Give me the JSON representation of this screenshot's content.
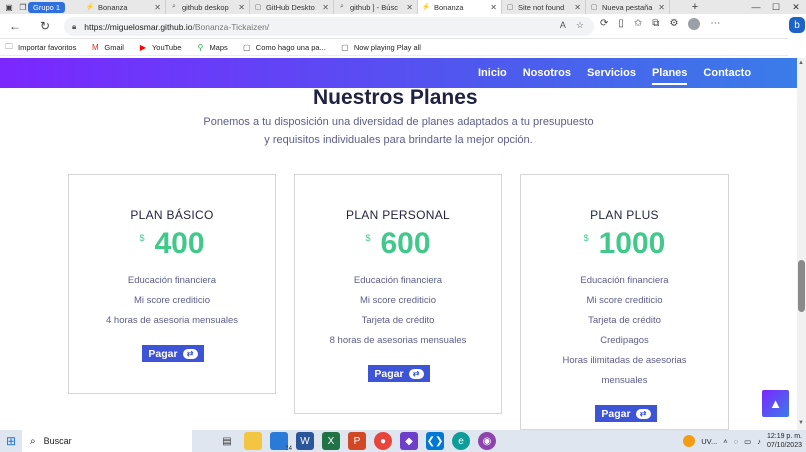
{
  "browser": {
    "group_chip": "Grupo 1",
    "tabs": [
      {
        "title": "Bonanza",
        "icon": "bonanza-icon",
        "active": false
      },
      {
        "title": "github deskop",
        "icon": "search-icon",
        "active": false
      },
      {
        "title": "GitHub Deskto",
        "icon": "page-icon",
        "active": false
      },
      {
        "title": "github ] - Búsc",
        "icon": "search-icon",
        "active": false
      },
      {
        "title": "Bonanza",
        "icon": "bonanza-icon",
        "active": true
      },
      {
        "title": "Site not found",
        "icon": "page-icon",
        "active": false
      },
      {
        "title": "Nueva pestaña",
        "icon": "newtab-icon",
        "active": false
      }
    ],
    "url_host": "https://miguelosmar.github.io",
    "url_path": "/Bonanza-Tickaizen/",
    "bookmarks": [
      {
        "label": "Importar favoritos",
        "icon": "folder-icon"
      },
      {
        "label": "Gmail",
        "icon": "gmail-icon"
      },
      {
        "label": "YouTube",
        "icon": "youtube-icon"
      },
      {
        "label": "Maps",
        "icon": "maps-icon"
      },
      {
        "label": "Como hago una pa...",
        "icon": "page-icon"
      },
      {
        "label": "Now playing Play all",
        "icon": "page-icon"
      }
    ]
  },
  "site": {
    "nav": [
      {
        "label": "Inicio",
        "active": false
      },
      {
        "label": "Nosotros",
        "active": false
      },
      {
        "label": "Servicios",
        "active": false
      },
      {
        "label": "Planes",
        "active": true
      },
      {
        "label": "Contacto",
        "active": false
      }
    ],
    "section_title": "Nuestros Planes",
    "section_sub_line1": "Ponemos a tu disposición una diversidad de planes adaptados a tu presupuesto",
    "section_sub_line2": "y requisitos individuales para brindarte la mejor opción.",
    "pay_label": "Pagar",
    "plans": [
      {
        "name": "PLAN BÁSICO",
        "currency": "$",
        "price": "400",
        "features": [
          "Educación financiera",
          "Mi score crediticio",
          "4 horas de asesoria mensuales"
        ]
      },
      {
        "name": "PLAN PERSONAL",
        "currency": "$",
        "price": "600",
        "features": [
          "Educación financiera",
          "Mi score crediticio",
          "Tarjeta de crédito",
          "8 horas de asesorias mensuales"
        ]
      },
      {
        "name": "PLAN PLUS",
        "currency": "$",
        "price": "1000",
        "features": [
          "Educación financiera",
          "Mi score crediticio",
          "Tarjeta de crédito",
          "Credipagos",
          "Horas ilimitadas de asesorias",
          "mensuales"
        ]
      }
    ]
  },
  "taskbar": {
    "search_label": "Buscar",
    "tray_label": "UV...",
    "time": "12:19 p. m.",
    "date": "07/10/2023",
    "badge": "14"
  }
}
